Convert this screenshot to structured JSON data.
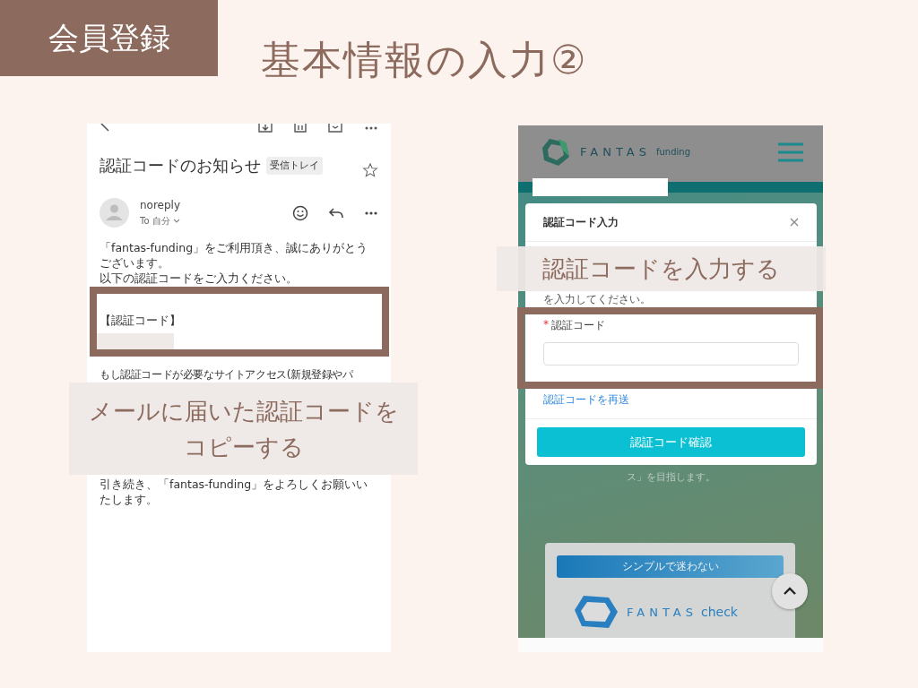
{
  "header": {
    "tag": "会員登録",
    "title": "基本情報の入力②"
  },
  "email": {
    "subject": "認証コードのお知らせ",
    "label": "受信トレイ",
    "sender": "noreply",
    "recipient": "To 自分",
    "body": [
      "「fantas-funding」をご利用頂き、誠にありがとうございます。",
      "以下の認証コードをご入力ください。"
    ],
    "code_heading": "【認証コード】",
    "after_code": "もし認証コードが必要なサイトアクセス(新規登録やパ",
    "closing": "引き続き、「fantas-funding」をよろしくお願いいたします。"
  },
  "site": {
    "logo": "FANTAS",
    "logo_sub": "funding",
    "modal": {
      "title": "認証コード入力",
      "instruction": "を入力してください。",
      "required_mark": "*",
      "field_label": "認証コード",
      "resend": "認証コードを再送",
      "submit": "認証コード確認"
    },
    "background_text": "ス」を目指します。",
    "card": {
      "tag": "シンプルで迷わない",
      "logo": "FANTAS",
      "logo_sub": "check"
    }
  },
  "callouts": [
    {
      "lines": [
        "メールに届いた認証コードを",
        "コピーする"
      ]
    },
    {
      "lines": [
        "認証コードを入力する"
      ]
    }
  ]
}
